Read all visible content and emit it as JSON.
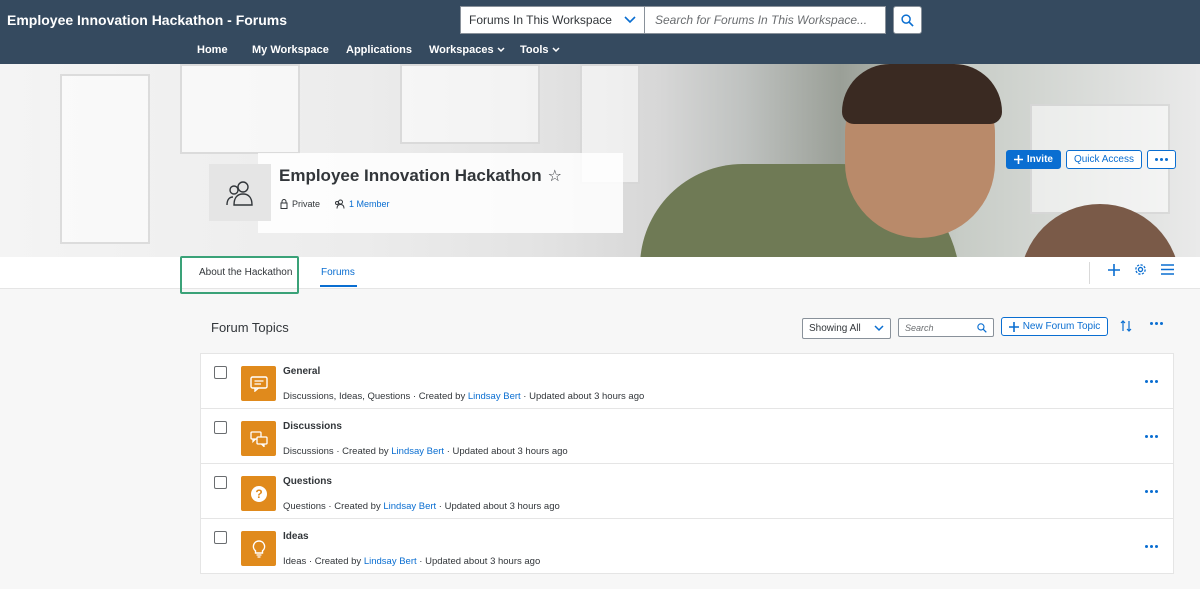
{
  "header": {
    "title": "Employee Innovation Hackathon - Forums",
    "scope_select": "Forums In This Workspace",
    "search_placeholder": "Search for Forums In This Workspace..."
  },
  "nav": {
    "items": [
      {
        "label": "Home"
      },
      {
        "label": "My Workspace"
      },
      {
        "label": "Applications"
      },
      {
        "label": "Workspaces",
        "has_dropdown": true
      },
      {
        "label": "Tools",
        "has_dropdown": true
      }
    ]
  },
  "workspace": {
    "name": "Employee Innovation Hackathon",
    "favorite_icon": "star-outline-icon",
    "privacy": "Private",
    "members": "1 Member"
  },
  "banner_actions": {
    "invite": "Invite",
    "quick_access": "Quick Access"
  },
  "tabs": [
    {
      "label": "About the Hackathon",
      "active": false
    },
    {
      "label": "Forums",
      "active": true
    }
  ],
  "forum_section": {
    "title": "Forum Topics",
    "filter": "Showing All",
    "search_placeholder": "Search",
    "new_topic": "New Forum Topic"
  },
  "topics": [
    {
      "name": "General",
      "icon": "comment-icon",
      "types": "Discussions, Ideas, Questions",
      "created_prefix": "Created by",
      "author": "Lindsay Bert",
      "updated": "Updated about 3 hours ago"
    },
    {
      "name": "Discussions",
      "icon": "discussion-icon",
      "types": "Discussions",
      "created_prefix": "Created by",
      "author": "Lindsay Bert",
      "updated": "Updated about 3 hours ago"
    },
    {
      "name": "Questions",
      "icon": "question-icon",
      "types": "Questions",
      "created_prefix": "Created by",
      "author": "Lindsay Bert",
      "updated": "Updated about 3 hours ago"
    },
    {
      "name": "Ideas",
      "icon": "lightbulb-icon",
      "types": "Ideas",
      "created_prefix": "Created by",
      "author": "Lindsay Bert",
      "updated": "Updated about 3 hours ago"
    }
  ],
  "colors": {
    "header_bg": "#354a5f",
    "accent": "#0a6ed1",
    "forum_icon_bg": "#e08a1c",
    "highlight": "#3aa278"
  }
}
